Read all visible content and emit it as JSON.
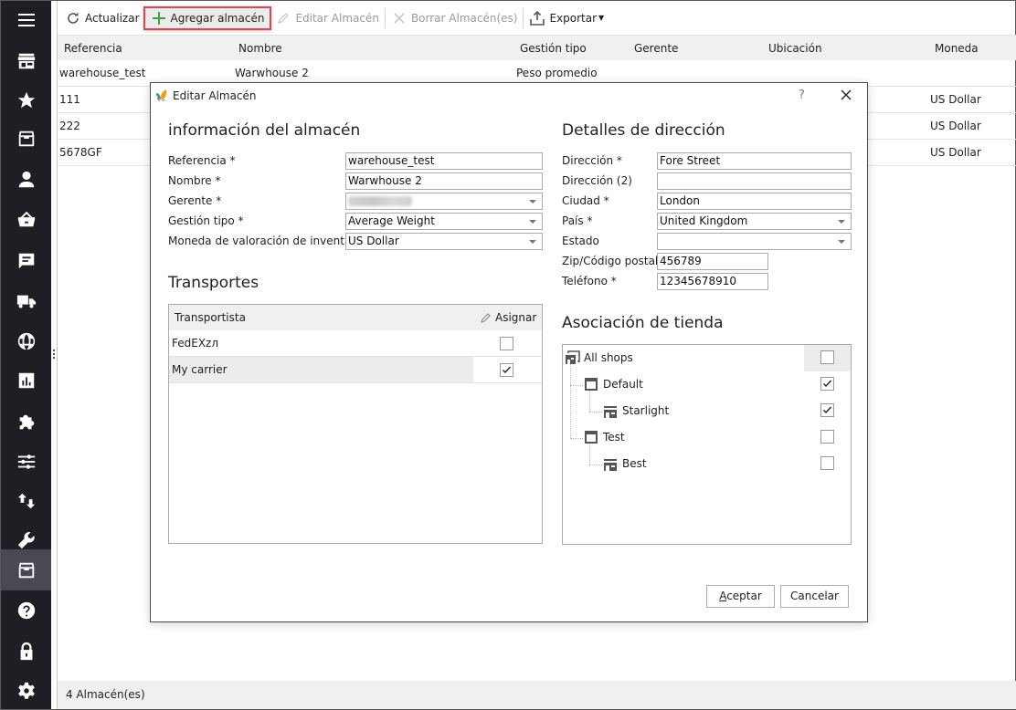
{
  "sidebar": {
    "items": [
      {
        "icon": "menu-icon",
        "label": "Menu"
      },
      {
        "icon": "store-icon",
        "label": "Store"
      },
      {
        "icon": "star-icon",
        "label": "Favorites"
      },
      {
        "icon": "inbox-icon",
        "label": "Catalog"
      },
      {
        "icon": "user-icon",
        "label": "Customers"
      },
      {
        "icon": "basket-icon",
        "label": "Orders"
      },
      {
        "icon": "message-icon",
        "label": "Messages"
      },
      {
        "icon": "truck-icon",
        "label": "Shipping"
      },
      {
        "icon": "globe-icon",
        "label": "Localization"
      },
      {
        "icon": "chart-icon",
        "label": "Stats"
      },
      {
        "icon": "puzzle-icon",
        "label": "Modules"
      },
      {
        "icon": "sliders-icon",
        "label": "Preferences"
      },
      {
        "icon": "import-export-icon",
        "label": "Import/Export"
      },
      {
        "icon": "wrench-icon",
        "label": "Tools"
      },
      {
        "icon": "warehouse-icon",
        "label": "Warehouses",
        "active": true
      },
      {
        "icon": "help-icon",
        "label": "Help"
      },
      {
        "icon": "lock-icon",
        "label": "Security"
      },
      {
        "icon": "gear-icon",
        "label": "Settings"
      }
    ]
  },
  "toolbar": {
    "refresh": "Actualizar",
    "add": "Agregar almacén",
    "edit": "Editar Almacén",
    "delete": "Borrar Almacén(es)",
    "export": "Exportar"
  },
  "grid": {
    "columns": [
      "Referencia",
      "Nombre",
      "Gestión tipo",
      "Gerente",
      "Ubicación",
      "Moneda"
    ],
    "rows": [
      {
        "ref": "warehouse_test",
        "name": "Warwhouse 2",
        "type": "Peso promedio",
        "manager": "",
        "location": "",
        "currency": ""
      },
      {
        "ref": "111",
        "name": "",
        "type": "",
        "manager": "",
        "location": "",
        "currency": "US Dollar"
      },
      {
        "ref": "222",
        "name": "",
        "type": "",
        "manager": "",
        "location": "",
        "currency": "US Dollar"
      },
      {
        "ref": "5678GF",
        "name": "",
        "type": "",
        "manager": "",
        "location": "",
        "currency": "US Dollar"
      }
    ]
  },
  "status": {
    "count_text": "4 Almacén(es)"
  },
  "dialog": {
    "title": "Editar Almacén",
    "help": "?",
    "info": {
      "title": "información del almacén",
      "fields": [
        {
          "label": "Referencia *",
          "value": "warehouse_test",
          "type": "text"
        },
        {
          "label": "Nombre *",
          "value": "Warwhouse 2",
          "type": "text"
        },
        {
          "label": "Gerente *",
          "value": "",
          "type": "select",
          "redacted": true
        },
        {
          "label": "Gestión tipo *",
          "value": "Average Weight",
          "type": "select"
        },
        {
          "label": "Moneda de valoración de inventario*",
          "value": "US Dollar",
          "type": "select"
        }
      ]
    },
    "transport": {
      "title": "Transportes",
      "col_carrier": "Transportista",
      "col_assign": "Asignar",
      "rows": [
        {
          "name": "FedEXzл",
          "checked": false
        },
        {
          "name": "My carrier",
          "checked": true
        }
      ]
    },
    "address": {
      "title": "Detalles de dirección",
      "fields": [
        {
          "label": "Dirección *",
          "value": "Fore Street",
          "type": "text"
        },
        {
          "label": "Dirección (2)",
          "value": "",
          "type": "text"
        },
        {
          "label": "Ciudad *",
          "value": "London",
          "type": "text"
        },
        {
          "label": "País *",
          "value": "United Kingdom",
          "type": "select"
        },
        {
          "label": "Estado",
          "value": "",
          "type": "select"
        },
        {
          "label": "Zip/Código postal *",
          "value": "456789",
          "type": "text"
        },
        {
          "label": "Teléfono *",
          "value": "12345678910",
          "type": "text"
        }
      ]
    },
    "shops": {
      "title": "Asociación de tienda",
      "tree": [
        {
          "label": "All shops",
          "level": 0,
          "kind": "root",
          "checked": false
        },
        {
          "label": "Default",
          "level": 1,
          "kind": "group",
          "checked": true
        },
        {
          "label": "Starlight",
          "level": 2,
          "kind": "shop",
          "checked": true
        },
        {
          "label": "Test",
          "level": 1,
          "kind": "group",
          "checked": false
        },
        {
          "label": "Best",
          "level": 2,
          "kind": "shop",
          "checked": false
        }
      ]
    },
    "ok": "Aceptar",
    "cancel": "Cancelar"
  }
}
